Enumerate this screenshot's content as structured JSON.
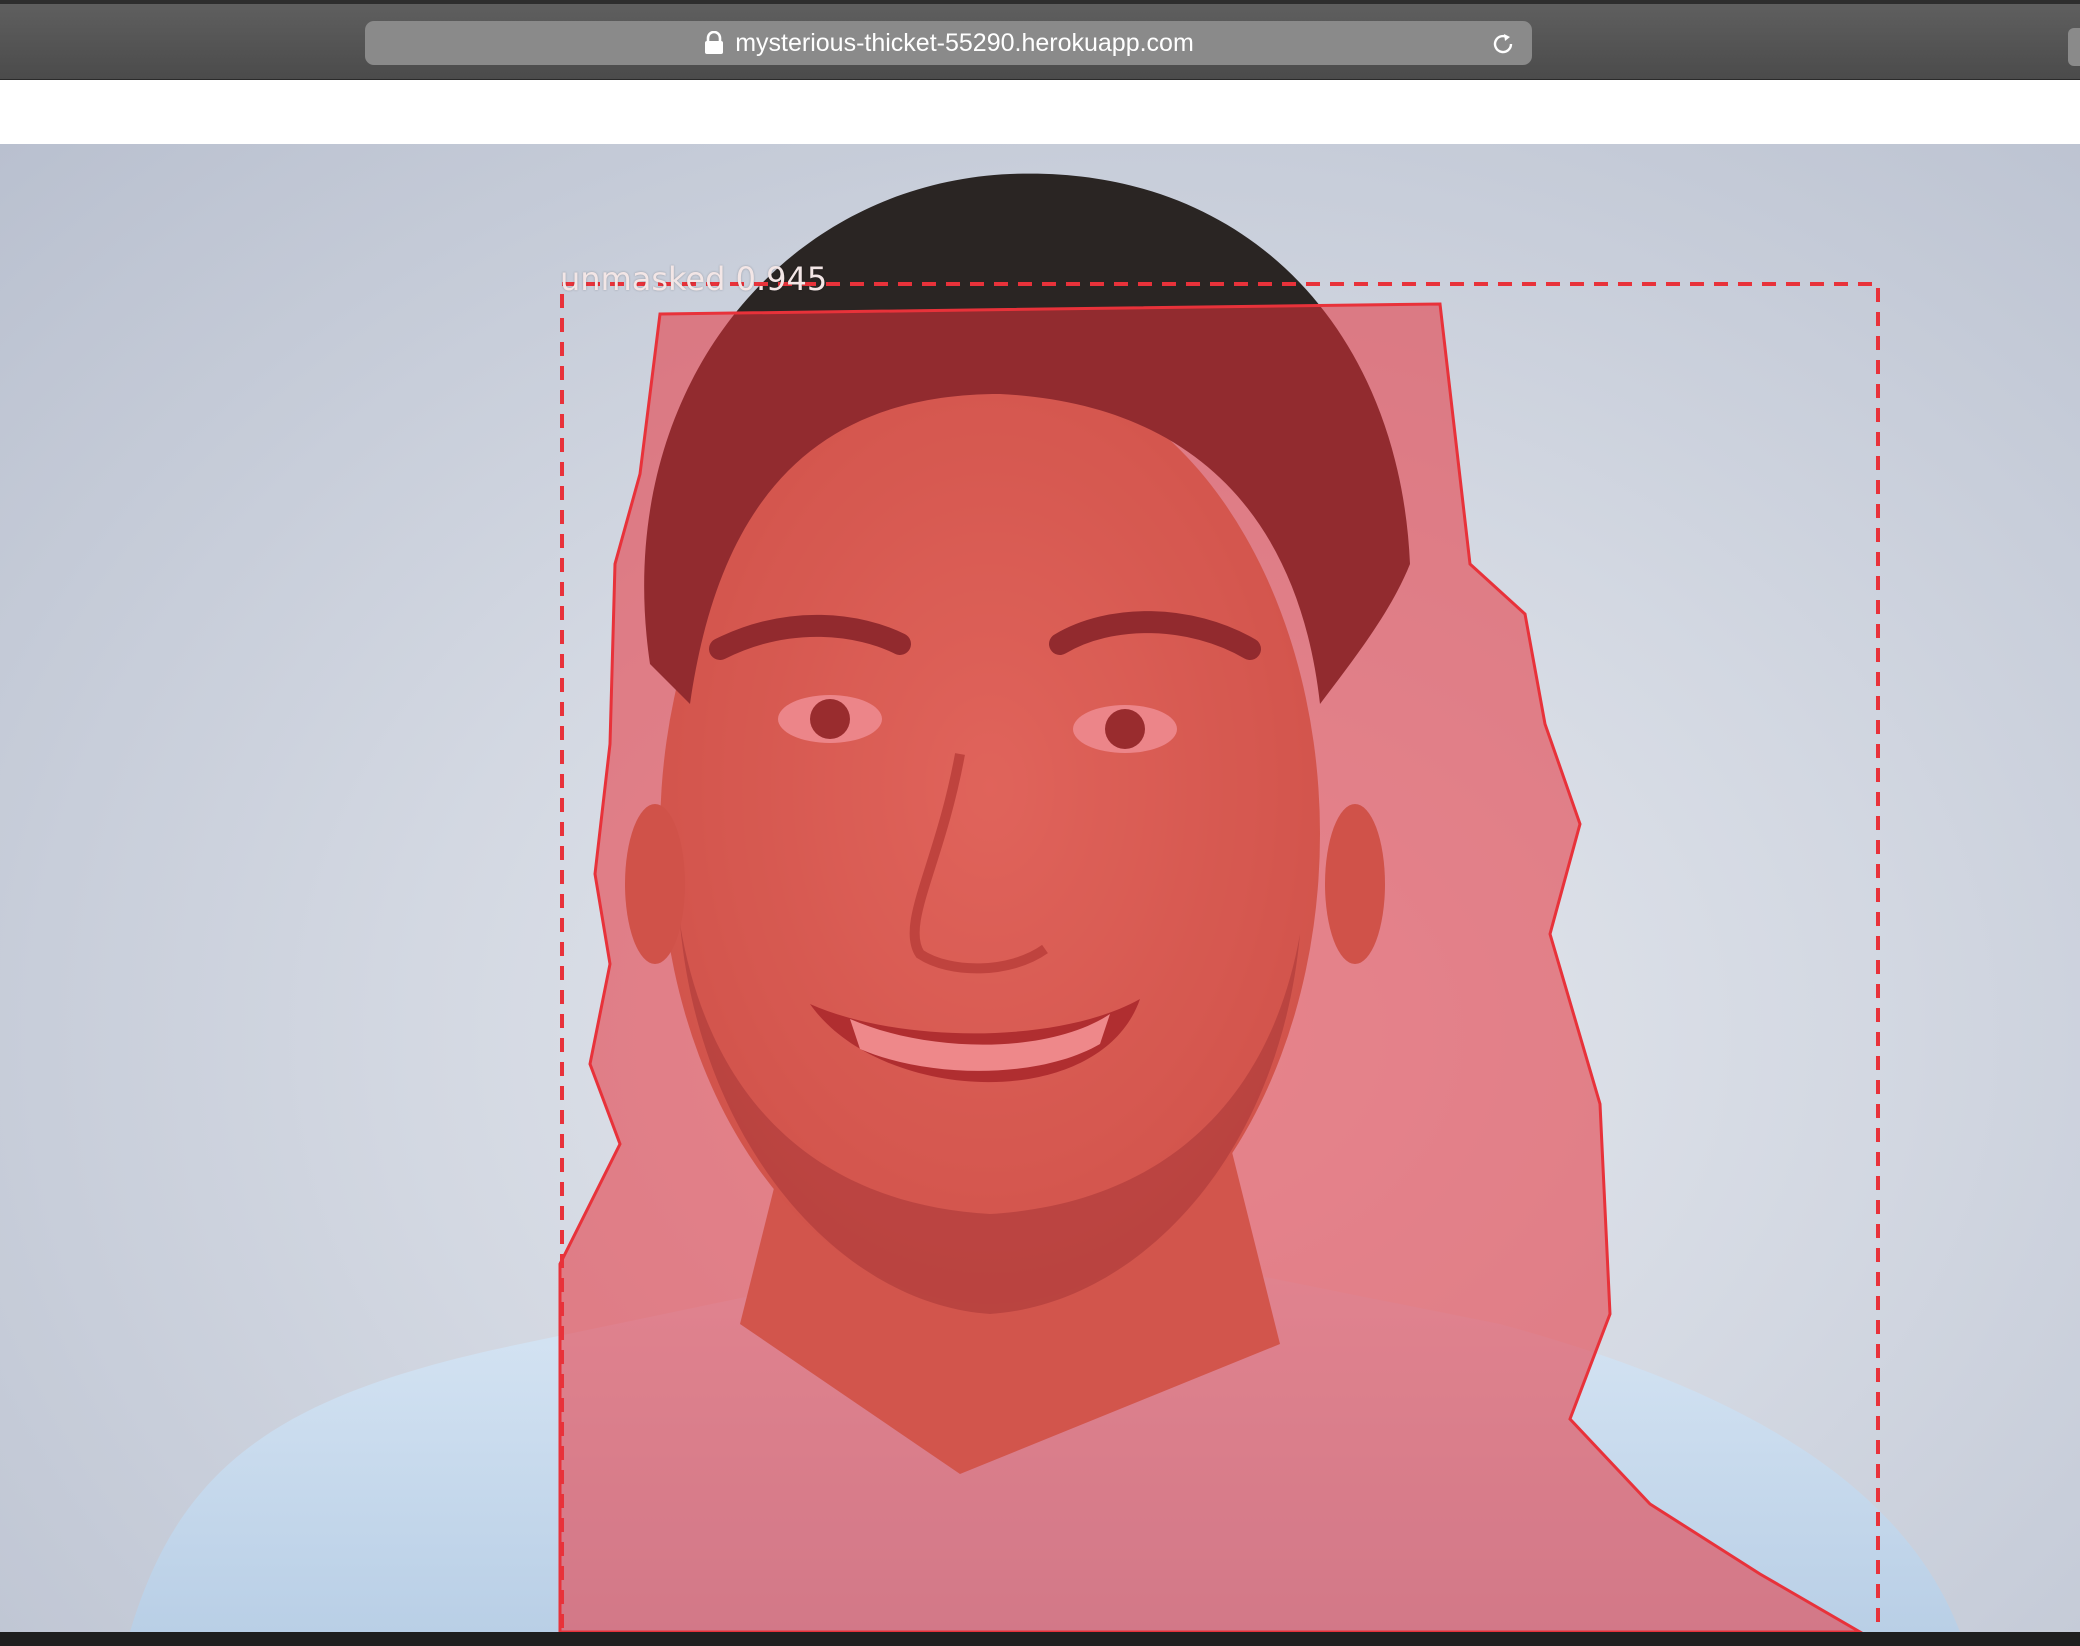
{
  "browser": {
    "url": "mysterious-thicket-55290.herokuapp.com",
    "icons": {
      "lock": "lock-icon",
      "reload": "reload-icon"
    }
  },
  "detection": {
    "label": "unmasked 0.945",
    "class": "unmasked",
    "confidence": 0.945,
    "mask_color": "#e8323a",
    "box_color": "#e8323a"
  }
}
